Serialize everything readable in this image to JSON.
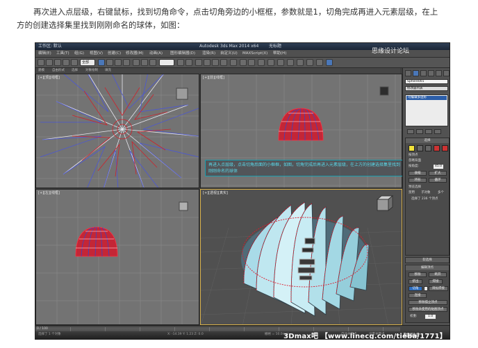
{
  "article": {
    "line1": "再次进入点层级，右键鼠标，找到切角命令，点击切角旁边的小框框，参数就是1，切角完成再进入元素层级，在上",
    "line2": "方的创建选择集里找到刚刚命名的球体，如图："
  },
  "window": {
    "title": "Autodesk 3ds Max 2014 x64",
    "file_label": "工作区: 默认",
    "tab_name": "无标题"
  },
  "menu": [
    "编辑(E)",
    "工具(T)",
    "组(G)",
    "视图(V)",
    "创建(C)",
    "修改器(M)",
    "动画(A)",
    "图形编辑器(D)",
    "渲染(R)",
    "自定义(U)",
    "MAXScript(X)",
    "帮助(H)"
  ],
  "toolbar": {
    "selection_filter": "全部"
  },
  "ribbon": {
    "tabs": [
      "建模",
      "自由形式",
      "选择",
      "对象绘制",
      "填充"
    ]
  },
  "viewports": {
    "top_label": "[+][顶][线框]",
    "front_label": "[+][前][线框]",
    "left_label": "[+][左][线框]",
    "persp_label": "[+][透视][真实]"
  },
  "annotation": {
    "text": "再进入点层级，点击切角后面的小框框，如图，切角完成后再进入元素层级，在上方的创建选择集里找到刚刚命名的球体"
  },
  "command_panel": {
    "object_name": "Sphere001",
    "modifier_list": "修改器列表",
    "stack_item": "可编辑多边形",
    "selection_rollout": "选择",
    "by_vertex": "按顶点",
    "ignore_backfacing": "忽略背面",
    "by_angle": "按角度:",
    "angle_value": "45.0",
    "shrink": "收缩",
    "grow": "扩大",
    "ring": "环形",
    "loop": "循环",
    "preview_selection": "预览选择",
    "preview_options": [
      "禁用",
      "子对象",
      "多个"
    ],
    "selected_count": "选择了 236 个顶点",
    "soft_selection": "软选择",
    "edit_vertices": "编辑顶点",
    "remove": "移除",
    "break": "断开",
    "extrude": "挤出",
    "weld": "焊接",
    "chamfer": "切角",
    "target_weld": "目标焊接",
    "connect": "连接",
    "remove_isolated": "移除孤立顶点",
    "remove_unused_map": "移除未使用的贴图顶点",
    "weight_label": "权重:",
    "weight_value": "1.0"
  },
  "status": {
    "frame": "0 / 100",
    "selected": "选择了 1 个对象",
    "coords": "X: -14.39  Y: 1.23  Z: 0.0",
    "grid": "栅格 = 10.0mm",
    "autokey": "自动关键点",
    "setkey": "设置关键点",
    "selected_obj": "选定对象"
  },
  "watermark": "思缘设计论坛",
  "bottom_caption": "3Dmax吧 【www.linecg.com/tieba/1771】",
  "colors": {
    "viewport_gray": "#737373",
    "wire_red": "#d0202a",
    "wire_blue": "#2a3fd8",
    "active_border": "#d8b14b"
  }
}
